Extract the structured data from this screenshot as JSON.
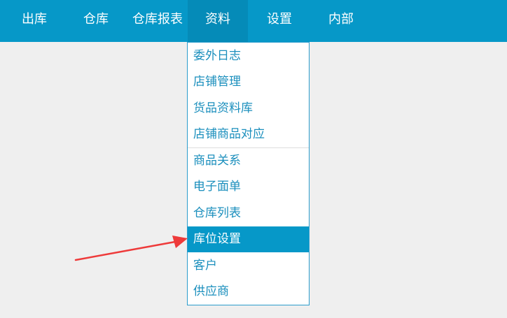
{
  "nav": {
    "items": [
      {
        "label": "出库"
      },
      {
        "label": "仓库"
      },
      {
        "label": "仓库报表"
      },
      {
        "label": "资料"
      },
      {
        "label": "设置"
      },
      {
        "label": "内部"
      }
    ],
    "active_label": "资料"
  },
  "dropdown": {
    "items": [
      {
        "label": "委外日志"
      },
      {
        "label": "店铺管理"
      },
      {
        "label": "货品资料库"
      },
      {
        "label": "店铺商品对应"
      },
      {
        "label": "商品关系"
      },
      {
        "label": "电子面单"
      },
      {
        "label": "仓库列表"
      },
      {
        "label": "库位设置"
      },
      {
        "label": "客户"
      },
      {
        "label": "供应商"
      }
    ],
    "selected_label": "库位设置"
  },
  "colors": {
    "topbar": "#0698c8",
    "menu_text": "#1b8fbd",
    "highlight": "#0698c8",
    "annotation_arrow": "#ee3a3a",
    "background": "#efefef"
  }
}
